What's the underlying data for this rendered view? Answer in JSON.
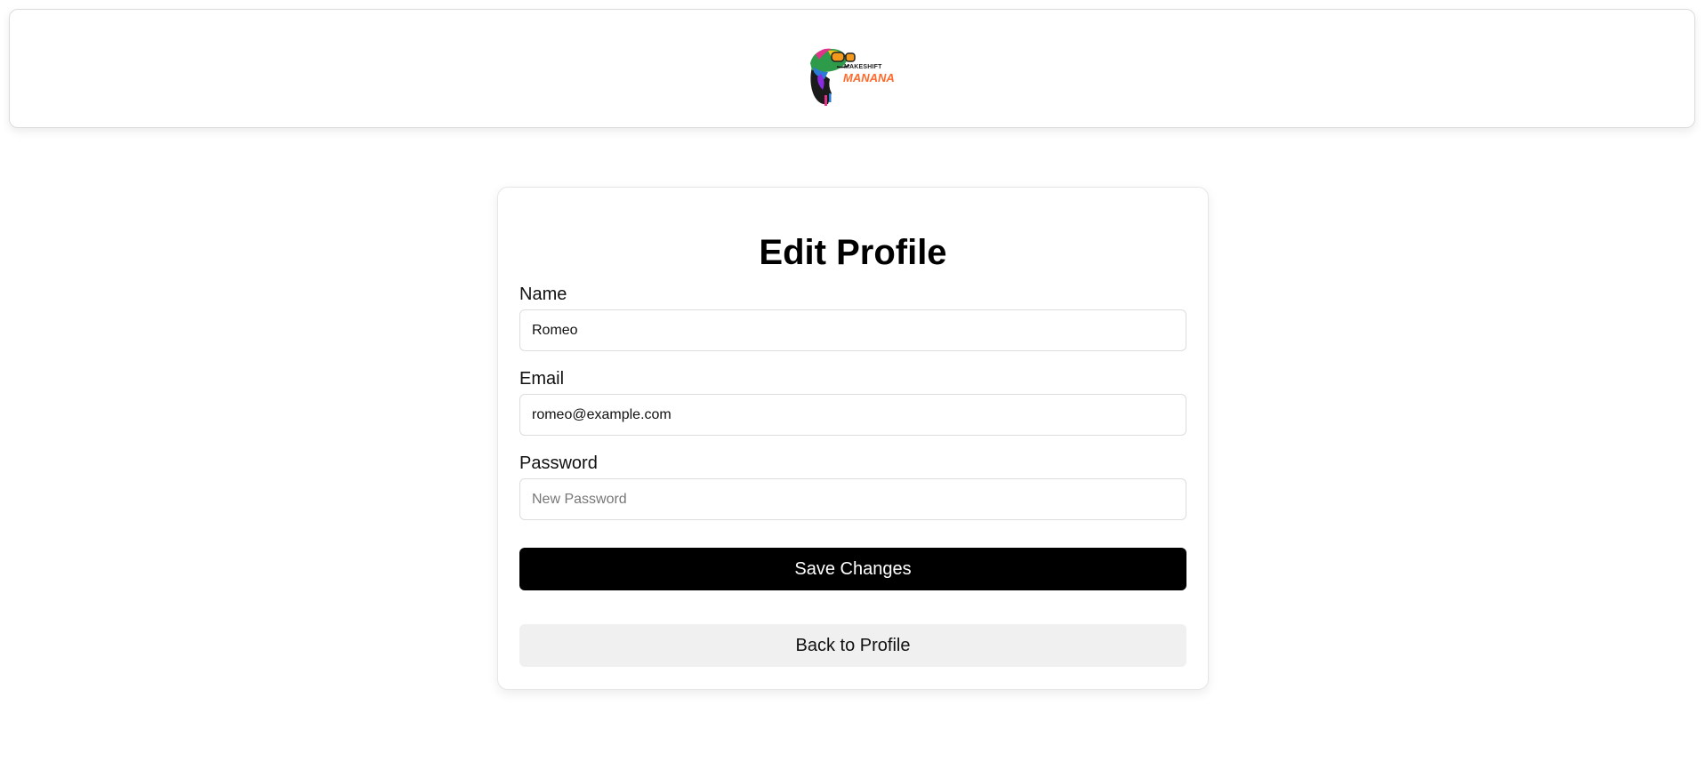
{
  "form": {
    "title": "Edit Profile",
    "name_label": "Name",
    "name_value": "Romeo",
    "email_label": "Email",
    "email_value": "romeo@example.com",
    "password_label": "Password",
    "password_value": "",
    "password_placeholder": "New Password",
    "save_label": "Save Changes",
    "back_label": "Back to Profile"
  },
  "logo": {
    "icon": "chameleon-logo",
    "text_top": "MAKESHIFT",
    "text_bottom": "MANANA",
    "accent_color": "#ff6a2b"
  },
  "colors": {
    "primary_button": "#000000",
    "secondary_button": "#f0f0f0"
  }
}
